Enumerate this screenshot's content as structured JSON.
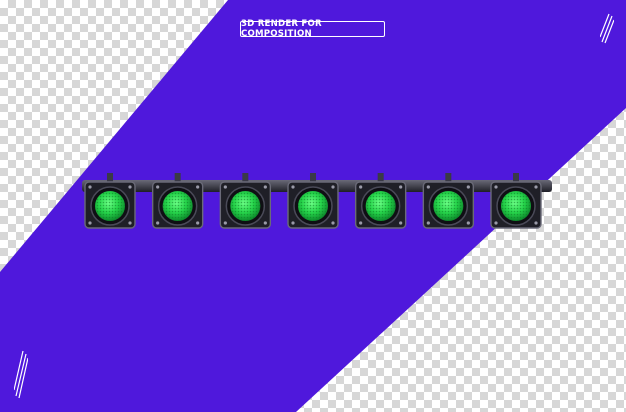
{
  "badge": {
    "text": "3D RENDER FOR COMPOSITION"
  },
  "colors": {
    "band": "#4f18dc",
    "lamp_green": "#25d44a",
    "housing": "#1f1f27",
    "housing_edge": "#6a6a78",
    "checker_dark": "#d7d7d7",
    "checker_light": "#ffffff"
  },
  "lights": {
    "count": 7,
    "lamp_color": "green"
  }
}
